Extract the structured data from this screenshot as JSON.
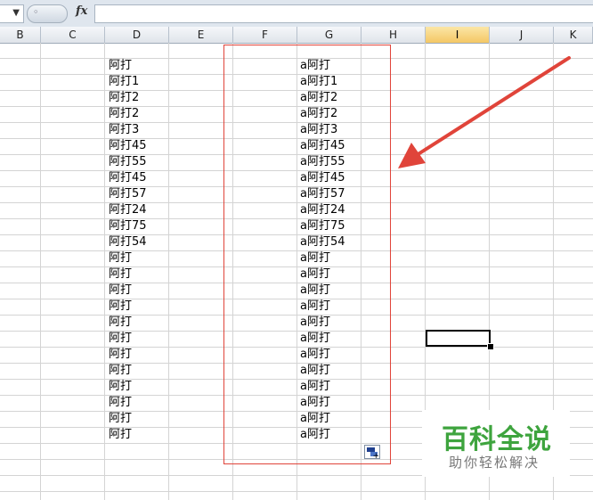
{
  "formula_bar": {
    "fx_label": "fx",
    "formula_value": ""
  },
  "columns": [
    {
      "label": "B",
      "selected": false
    },
    {
      "label": "C",
      "selected": false
    },
    {
      "label": "D",
      "selected": false
    },
    {
      "label": "E",
      "selected": false
    },
    {
      "label": "F",
      "selected": false
    },
    {
      "label": "G",
      "selected": false
    },
    {
      "label": "H",
      "selected": false
    },
    {
      "label": "I",
      "selected": true
    },
    {
      "label": "J",
      "selected": false
    },
    {
      "label": "K",
      "selected": false
    }
  ],
  "column_d": [
    "阿打",
    "阿打1",
    "阿打2",
    "阿打2",
    "阿打3",
    "阿打45",
    "阿打55",
    "阿打45",
    "阿打57",
    "阿打24",
    "阿打75",
    "阿打54",
    "阿打",
    "阿打",
    "阿打",
    "阿打",
    "阿打",
    "阿打",
    "阿打",
    "阿打",
    "阿打",
    "阿打",
    "阿打",
    "阿打"
  ],
  "column_g": [
    "a阿打",
    "a阿打1",
    "a阿打2",
    "a阿打2",
    "a阿打3",
    "a阿打45",
    "a阿打55",
    "a阿打45",
    "a阿打57",
    "a阿打24",
    "a阿打75",
    "a阿打54",
    "a阿打",
    "a阿打",
    "a阿打",
    "a阿打",
    "a阿打",
    "a阿打",
    "a阿打",
    "a阿打",
    "a阿打",
    "a阿打",
    "a阿打",
    "a阿打"
  ],
  "watermark": {
    "title": "百科全说",
    "subtitle": "助你轻松解决"
  },
  "colors": {
    "highlight_box": "#e0443a",
    "arrow": "#e0443a",
    "selected_column_header": "#f4c765",
    "watermark_green": "#3ea43e"
  },
  "icons": {
    "paste_options": "paste-options-icon",
    "dropdown": "chevron-down-icon"
  }
}
